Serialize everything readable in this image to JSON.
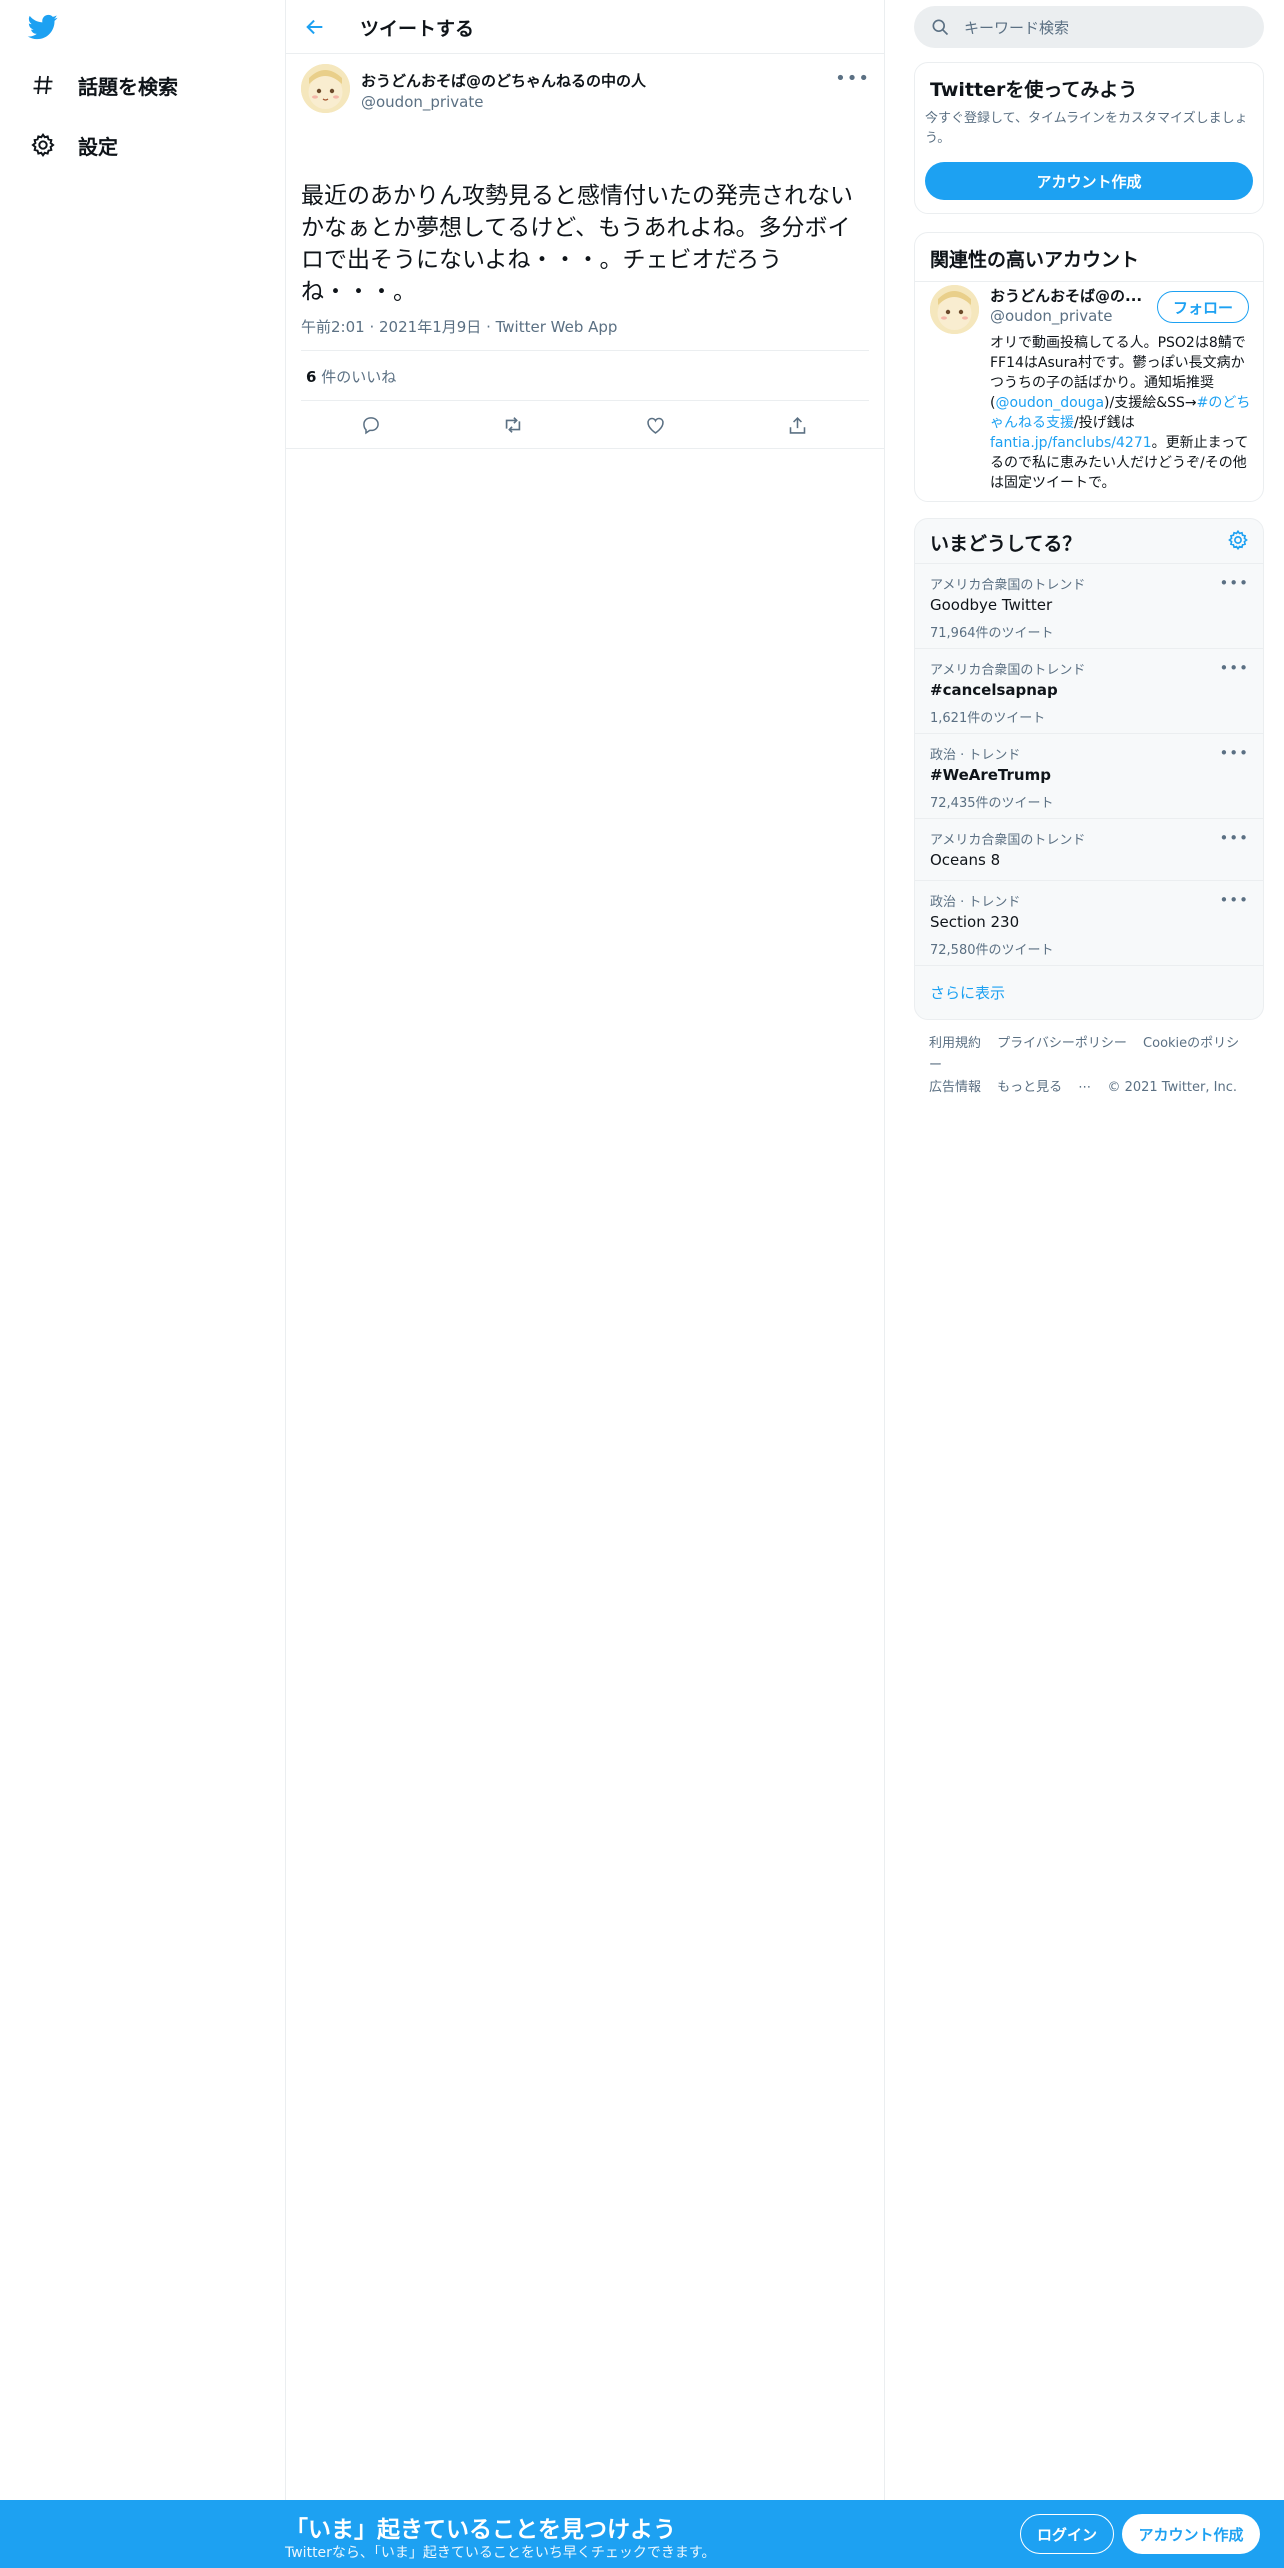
{
  "nav": {
    "items": [
      {
        "label": "話題を検索",
        "icon": "hashtag-icon"
      },
      {
        "label": "設定",
        "icon": "gear-icon"
      }
    ]
  },
  "header": {
    "title": "ツイートする"
  },
  "tweet": {
    "author_name": "おうどんおそば@のどちゃんねるの中の人",
    "author_handle": "@oudon_private",
    "text": "最近のあかりん攻勢見ると感情付いたの発売されないかなぁとか夢想してるけど、もうあれよね。多分ボイロで出そうにないよね・・・。チェビオだろうね・・・。",
    "time": "午前2:01",
    "date": "2021年1月9日",
    "source": "Twitter Web App",
    "likes_count": "6",
    "likes_label": "件のいいね"
  },
  "search": {
    "placeholder": "キーワード検索"
  },
  "signup_card": {
    "title": "Twitterを使ってみよう",
    "description": "今すぐ登録して、タイムラインをカスタマイズしましょう。",
    "button": "アカウント作成"
  },
  "related_card": {
    "title": "関連性の高いアカウント",
    "name": "おうどんおそば@の...",
    "handle": "@oudon_private",
    "follow": "フォロー",
    "bio_1": "オリで動画投稿してる人。PSO2は8鯖でFF14はAsura村です。鬱っぽい長文病かつうちの子の話ばかり。通知垢推奨(",
    "bio_link_1": "@oudon_douga",
    "bio_2": ")/支援絵&SS→",
    "bio_link_2": "#のどちゃんねる支援",
    "bio_3": "/投げ銭は",
    "bio_link_3": "fantia.jp/fanclubs/4271",
    "bio_4": "。更新止まってるので私に恵みたい人だけどうぞ/その他は固定ツイートで。"
  },
  "trends": {
    "title": "いまどうしてる？",
    "items": [
      {
        "context": "アメリカ合衆国のトレンド",
        "name": "Goodbye Twitter",
        "count": "71,964件のツイート"
      },
      {
        "context": "アメリカ合衆国のトレンド",
        "name": "#cancelsapnap",
        "count": "1,621件のツイート"
      },
      {
        "context": "政治 · トレンド",
        "name": "#WeAreTrump",
        "count": "72,435件のツイート"
      },
      {
        "context": "アメリカ合衆国のトレンド",
        "name": "Oceans 8",
        "count": ""
      },
      {
        "context": "政治 · トレンド",
        "name": "Section 230",
        "count": "72,580件のツイート"
      }
    ],
    "show_more": "さらに表示"
  },
  "footer": {
    "terms": "利用規約",
    "privacy": "プライバシーポリシー",
    "cookie": "Cookieのポリシー",
    "ads": "広告情報",
    "more": "もっと見る",
    "copyright": "© 2021 Twitter, Inc."
  },
  "bottom_bar": {
    "title": "「いま」起きていることを見つけよう",
    "subtitle": "Twitterなら、「いま」起きていることをいち早くチェックできます。",
    "login": "ログイン",
    "signup": "アカウント作成"
  },
  "colors": {
    "accent": "#1da1f2",
    "border": "#ebeef0",
    "muted": "#5b7083"
  }
}
